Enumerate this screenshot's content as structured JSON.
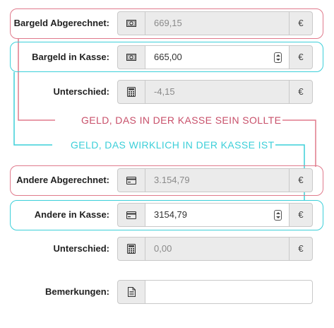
{
  "rows": {
    "cash_calculated": {
      "label": "Bargeld Abgerechnet:",
      "icon": "banknote-icon",
      "value": "669,15",
      "currency": "€"
    },
    "cash_in_register": {
      "label": "Bargeld in Kasse:",
      "icon": "banknote-icon",
      "value": "665,00",
      "currency": "€"
    },
    "cash_difference": {
      "label": "Unterschied:",
      "icon": "calculator-icon",
      "value": "-4,15",
      "currency": "€"
    },
    "other_calculated": {
      "label": "Andere Abgerechnet:",
      "icon": "credit-card-icon",
      "value": "3.154,79",
      "currency": "€"
    },
    "other_in_register": {
      "label": "Andere in Kasse:",
      "icon": "credit-card-icon",
      "value": "3154,79",
      "currency": "€"
    },
    "other_difference": {
      "label": "Unterschied:",
      "icon": "calculator-icon",
      "value": "0,00",
      "currency": "€"
    },
    "remarks": {
      "label": "Bemerkungen:",
      "icon": "document-icon",
      "value": ""
    }
  },
  "callouts": {
    "expected": "GELD, DAS IN DER KASSE SEIN SOLLTE",
    "actual": "GELD, DAS WIRKLICH IN DER KASSE IST"
  },
  "colors": {
    "expected_accent": "#e07a8c",
    "actual_accent": "#3ccfd9"
  }
}
